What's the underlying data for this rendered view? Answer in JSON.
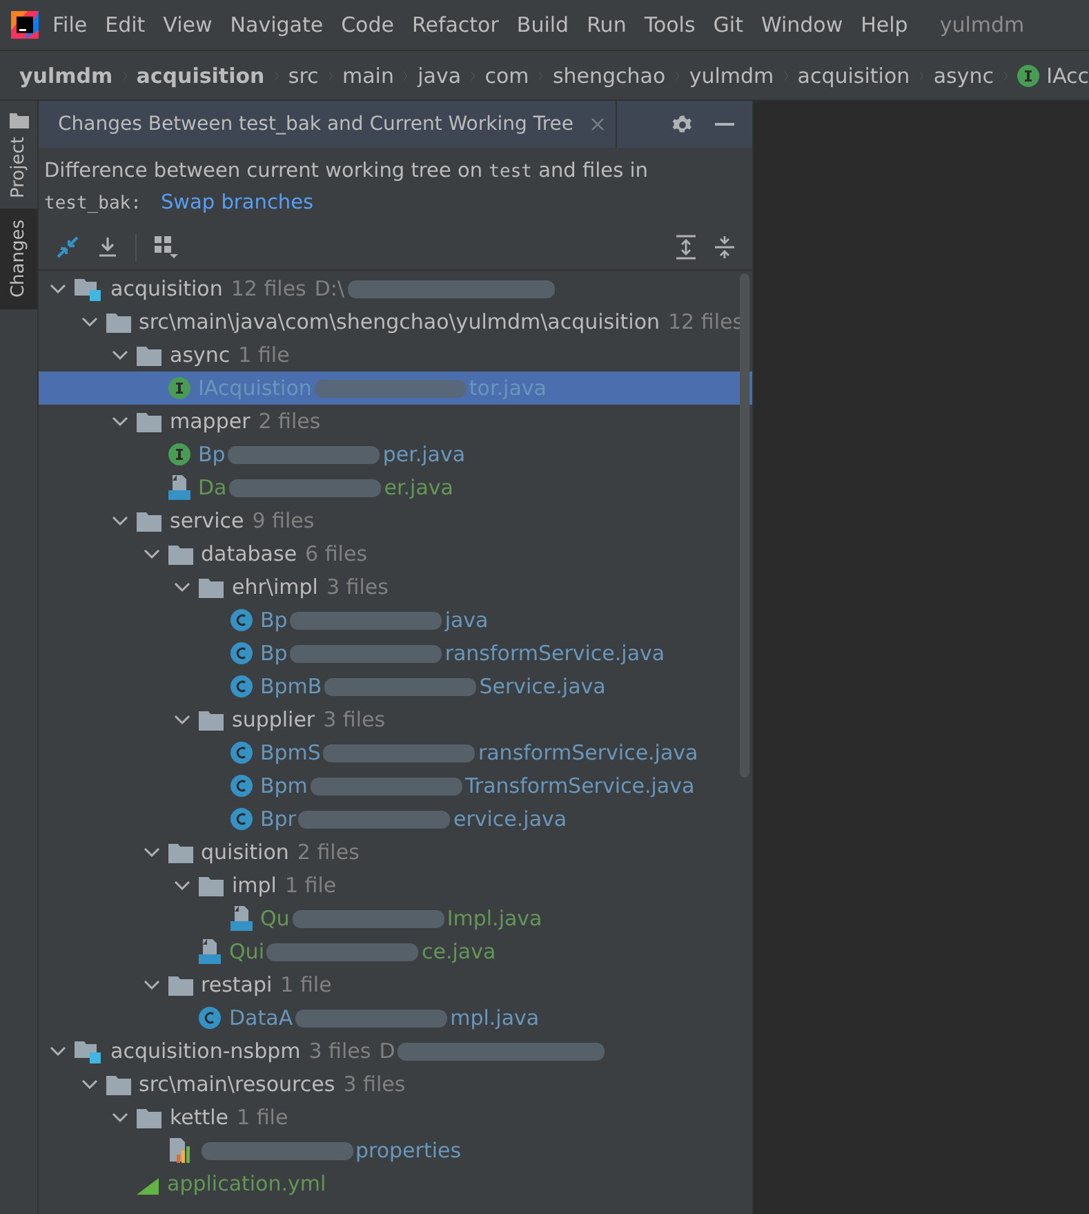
{
  "menu": [
    "File",
    "Edit",
    "View",
    "Navigate",
    "Code",
    "Refactor",
    "Build",
    "Run",
    "Tools",
    "Git",
    "Window",
    "Help"
  ],
  "window": {
    "title": "yulmdm"
  },
  "breadcrumb": [
    {
      "label": "yulmdm",
      "kind": "module"
    },
    {
      "label": "acquisition",
      "kind": "module"
    },
    {
      "label": "src",
      "kind": "folder"
    },
    {
      "label": "main",
      "kind": "folder"
    },
    {
      "label": "java",
      "kind": "folder"
    },
    {
      "label": "com",
      "kind": "folder"
    },
    {
      "label": "shengchao",
      "kind": "folder"
    },
    {
      "label": "yulmdm",
      "kind": "folder"
    },
    {
      "label": "acquisition",
      "kind": "folder"
    },
    {
      "label": "async",
      "kind": "folder"
    },
    {
      "label": "IAcc",
      "kind": "interface"
    }
  ],
  "side_tabs": [
    {
      "label": "Project",
      "selected": false
    },
    {
      "label": "Changes",
      "selected": true
    }
  ],
  "panel": {
    "title": "Changes Between test_bak and Current Working Tree",
    "description": "Difference between current working tree on",
    "current_branch": "test",
    "description_end": "and files in",
    "branch": "test_bak:",
    "swap_link": "Swap branches"
  },
  "tree": [
    {
      "kind": "module",
      "name": "acquisition",
      "count": "12 files",
      "path": "D:\\",
      "redacted": true,
      "expanded": true,
      "children": [
        {
          "kind": "folder",
          "name": "src\\main\\java\\com\\shengchao\\yulmdm\\acquisition",
          "count": "12 files",
          "expanded": true,
          "children": [
            {
              "kind": "folder",
              "name": "async",
              "count": "1 file",
              "expanded": true,
              "children": [
                {
                  "kind": "interface",
                  "name": "IAcquistion",
                  "suffix": "tor.java",
                  "redacted": true,
                  "color": "#6897bb",
                  "selected": true
                }
              ]
            },
            {
              "kind": "folder",
              "name": "mapper",
              "count": "2 files",
              "expanded": true,
              "children": [
                {
                  "kind": "interface",
                  "name": "Bp",
                  "suffix": "per.java",
                  "redacted": true,
                  "color": "#6897bb",
                  "selected": false
                },
                {
                  "kind": "java",
                  "name": "Da",
                  "suffix": "er.java",
                  "redacted": true,
                  "color": "#629755",
                  "selected": false
                }
              ]
            },
            {
              "kind": "folder",
              "name": "service",
              "count": "9 files",
              "expanded": true,
              "children": [
                {
                  "kind": "folder",
                  "name": "database",
                  "count": "6 files",
                  "expanded": true,
                  "children": [
                    {
                      "kind": "folder",
                      "name": "ehr\\impl",
                      "count": "3 files",
                      "expanded": true,
                      "children": [
                        {
                          "kind": "class",
                          "name": "Bp",
                          "suffix": "java",
                          "redacted": true,
                          "color": "#6897bb",
                          "selected": false
                        },
                        {
                          "kind": "class",
                          "name": "Bp",
                          "suffix": "ransformService.java",
                          "redacted": true,
                          "color": "#6897bb",
                          "selected": false
                        },
                        {
                          "kind": "class",
                          "name": "BpmB",
                          "suffix": "Service.java",
                          "redacted": true,
                          "color": "#6897bb",
                          "selected": false
                        }
                      ]
                    },
                    {
                      "kind": "folder",
                      "name": "supplier",
                      "count": "3 files",
                      "expanded": true,
                      "children": [
                        {
                          "kind": "class",
                          "name": "BpmS",
                          "suffix": "ransformService.java",
                          "redacted": true,
                          "color": "#6897bb",
                          "selected": false
                        },
                        {
                          "kind": "class",
                          "name": "Bpm",
                          "suffix": "TransformService.java",
                          "redacted": true,
                          "color": "#6897bb",
                          "selected": false
                        },
                        {
                          "kind": "class",
                          "name": "Bpr",
                          "suffix": "ervice.java",
                          "redacted": true,
                          "color": "#6897bb",
                          "selected": false
                        }
                      ]
                    }
                  ]
                },
                {
                  "kind": "folder",
                  "name": "quisition",
                  "count": "2 files",
                  "expanded": true,
                  "children": [
                    {
                      "kind": "folder",
                      "name": "impl",
                      "count": "1 file",
                      "expanded": true,
                      "children": [
                        {
                          "kind": "java",
                          "name": "Qu",
                          "suffix": "Impl.java",
                          "redacted": true,
                          "color": "#629755",
                          "selected": false
                        }
                      ]
                    },
                    {
                      "kind": "java",
                      "name": "Qui",
                      "suffix": "ce.java",
                      "redacted": true,
                      "color": "#629755",
                      "selected": false
                    }
                  ]
                },
                {
                  "kind": "folder",
                  "name": "restapi",
                  "count": "1 file",
                  "expanded": true,
                  "children": [
                    {
                      "kind": "class",
                      "name": "DataA",
                      "suffix": "mpl.java",
                      "redacted": true,
                      "color": "#6897bb",
                      "selected": false
                    }
                  ]
                }
              ]
            }
          ]
        }
      ]
    },
    {
      "kind": "module",
      "name": "acquisition-nsbpm",
      "count": "3 files",
      "path": "D",
      "redacted": true,
      "expanded": true,
      "children": [
        {
          "kind": "folder",
          "name": "src\\main\\resources",
          "count": "3 files",
          "expanded": true,
          "children": [
            {
              "kind": "folder",
              "name": "kettle",
              "count": "1 file",
              "expanded": true,
              "children": [
                {
                  "kind": "properties",
                  "suffix": "properties",
                  "redacted": true,
                  "color": "#6897bb",
                  "selected": false
                }
              ]
            },
            {
              "kind": "yml",
              "name": "application.yml",
              "color": "#629755",
              "selected": false
            }
          ]
        }
      ]
    }
  ]
}
